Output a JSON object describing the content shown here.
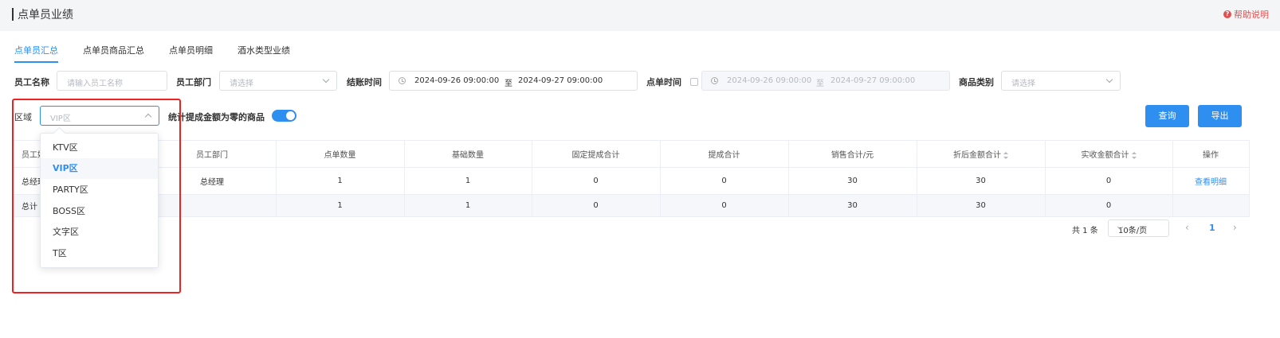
{
  "page_title": "点单员业绩",
  "help_label": "帮助说明",
  "tabs": [
    "点单员汇总",
    "点单员商品汇总",
    "点单员明细",
    "酒水类型业绩"
  ],
  "filters": {
    "employee_name_label": "员工名称",
    "employee_name_placeholder": "请输入员工名称",
    "department_label": "员工部门",
    "department_placeholder": "请选择",
    "checkout_time_label": "结账时间",
    "checkout_start": "2024-09-26 09:00:00",
    "checkout_sep": "至",
    "checkout_end": "2024-09-27 09:00:00",
    "order_time_label": "点单时间",
    "order_start": "2024-09-26 09:00:00",
    "order_sep": "至",
    "order_end": "2024-09-27 09:00:00",
    "category_label": "商品类别",
    "category_placeholder": "请选择",
    "area_label": "区域",
    "area_placeholder": "VIP区",
    "zero_commission_label": "统计提成金额为零的商品",
    "query_button": "查询",
    "export_button": "导出"
  },
  "area_options": [
    "KTV区",
    "VIP区",
    "PARTY区",
    "BOSS区",
    "文字区",
    "T区"
  ],
  "area_selected": "VIP区",
  "table": {
    "headers": [
      "员工姓名",
      "员工部门",
      "点单数量",
      "基础数量",
      "固定提成合计",
      "提成合计",
      "销售合计/元",
      "折后金额合计",
      "实收金额合计",
      "操作"
    ],
    "header_first_visible": "员工姓",
    "rows": [
      {
        "name": "总经理",
        "dept": "总经理",
        "order_qty": "1",
        "base_qty": "1",
        "fixed_comm": "0",
        "comm": "0",
        "sales": "30",
        "discounted": "30",
        "received": "0",
        "action": "查看明细"
      }
    ],
    "total": {
      "label": "总计",
      "order_qty": "1",
      "base_qty": "1",
      "fixed_comm": "0",
      "comm": "0",
      "sales": "30",
      "discounted": "30",
      "received": "0"
    }
  },
  "pagination": {
    "total_text": "共 1 条",
    "page_size": "10条/页",
    "current_page": "1",
    "prev_icon": "chevron-left-icon",
    "next_icon": "chevron-right-icon"
  },
  "colors": {
    "accent": "#2f8ff0",
    "highlight_box": "#ee2222",
    "help": "#e0504f"
  }
}
